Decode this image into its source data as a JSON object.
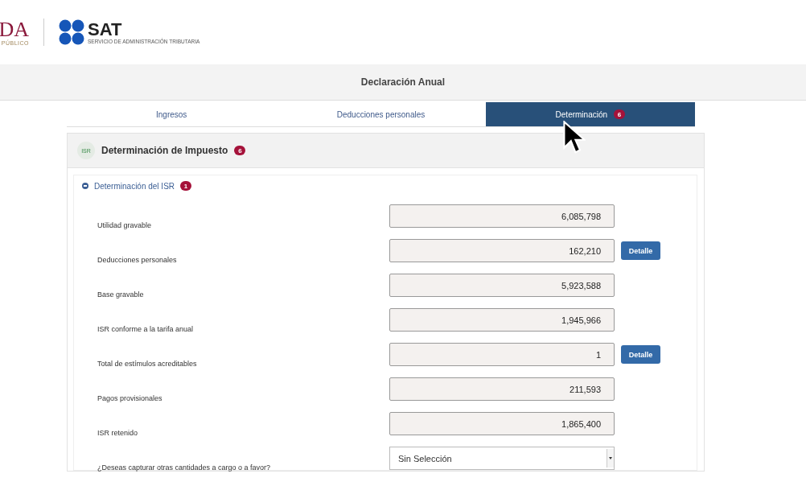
{
  "header": {
    "left_logo": {
      "mark": "DA",
      "caption": "PÚBLICO"
    },
    "sat_logo": {
      "name": "SAT",
      "subtitle": "SERVICIO DE ADMINISTRACIÓN TRIBUTARIA"
    }
  },
  "title": "Declaración Anual",
  "tabs": [
    {
      "label": "Ingresos",
      "selected": false
    },
    {
      "label": "Deducciones personales",
      "selected": false
    },
    {
      "label": "Determinación",
      "selected": true,
      "badge": "6"
    }
  ],
  "panel": {
    "icon_text": "ISR",
    "title": "Determinación de Impuesto",
    "badge": "6",
    "section": {
      "title": "Determinación del ISR",
      "badge": "1",
      "expanded": true,
      "groups": [
        [
          {
            "kind": "amount",
            "label": "Utilidad gravable",
            "value": "6,085,798"
          },
          {
            "kind": "amount",
            "label": "Deducciones personales",
            "value": "162,210",
            "button": "Detalle"
          },
          {
            "kind": "amount",
            "label": "Base gravable",
            "value": "5,923,588"
          },
          {
            "kind": "amount",
            "label": "ISR conforme a la tarifa anual",
            "value": "1,945,966"
          }
        ],
        [
          {
            "kind": "amount",
            "label": "Total de estímulos acreditables",
            "value": "1",
            "button": "Detalle"
          },
          {
            "kind": "amount",
            "label": "Pagos provisionales",
            "value": "211,593"
          },
          {
            "kind": "amount",
            "label": "ISR retenido",
            "value": "1,865,400"
          },
          {
            "kind": "select",
            "label": "¿Deseas capturar otras cantidades a cargo o a favor?",
            "value": "Sin Selección"
          }
        ]
      ]
    }
  }
}
